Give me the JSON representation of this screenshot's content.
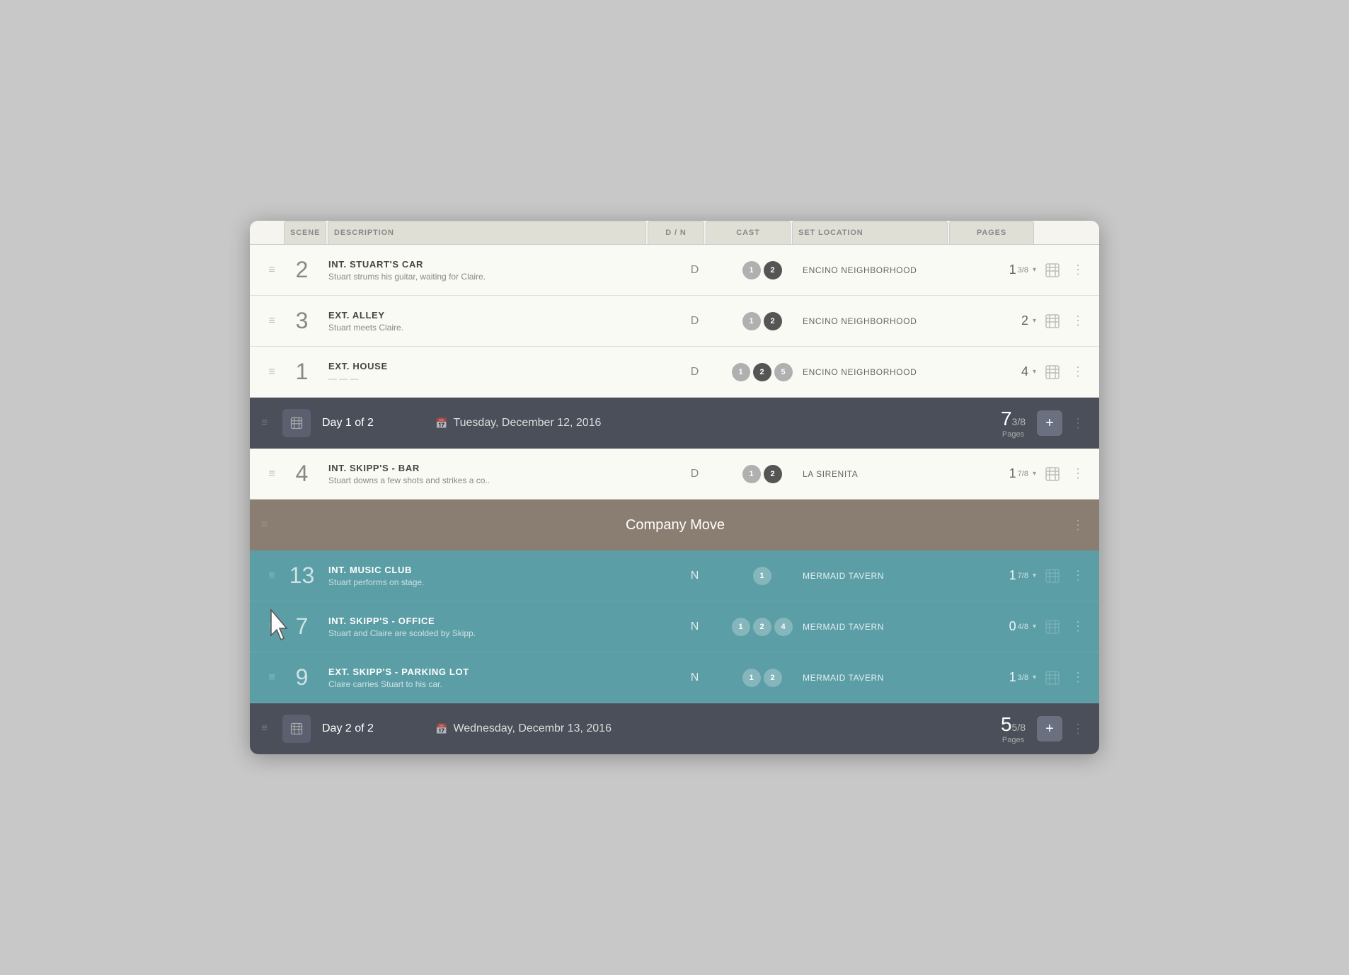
{
  "colors": {
    "bg": "#f5f4ee",
    "day_bar": "#4a4f5a",
    "company_move": "#8a7e72",
    "teal": "#5b9ea6",
    "row_light": "#fafaf4"
  },
  "column_headers": {
    "scene": "SCENE",
    "description": "DESCRIPTION",
    "dm": "D / N",
    "cast": "CAST",
    "location": "SET LOCATION",
    "pages": "PAGES"
  },
  "scenes": [
    {
      "num": "2",
      "title": "INT. STUART'S CAR",
      "description": "Stuart strums his guitar, waiting for Claire.",
      "dm": "D",
      "cast": [
        "1",
        "2"
      ],
      "location": "ENCINO NEIGHBORHOOD",
      "pages_main": "1",
      "pages_frac": "3/8",
      "row_type": "light"
    },
    {
      "num": "3",
      "title": "EXT. ALLEY",
      "description": "Stuart meets Claire.",
      "dm": "D",
      "cast": [
        "1",
        "2"
      ],
      "location": "ENCINO NEIGHBORHOOD",
      "pages_main": "2",
      "pages_frac": "",
      "row_type": "light"
    },
    {
      "num": "1",
      "title": "EXT. HOUSE",
      "description": "",
      "dm": "D",
      "cast": [
        "1",
        "2",
        "5"
      ],
      "location": "ENCINO NEIGHBORHOOD",
      "pages_main": "4",
      "pages_frac": "",
      "row_type": "light"
    }
  ],
  "day1_bar": {
    "title": "Day 1 of 2",
    "date": "Tuesday, December 12, 2016",
    "pages_main": "7",
    "pages_frac": "3/8",
    "pages_label": "Pages"
  },
  "scene4": {
    "num": "4",
    "title": "INT. SKIPP'S - BAR",
    "description": "Stuart downs a few shots and strikes a co..",
    "dm": "D",
    "cast": [
      "1",
      "2"
    ],
    "location": "LA SIRENITA",
    "pages_main": "1",
    "pages_frac": "7/8",
    "row_type": "light"
  },
  "company_move": {
    "title": "Company Move"
  },
  "teal_scenes": [
    {
      "num": "13",
      "title": "INT. MUSIC CLUB",
      "description": "Stuart performs on stage.",
      "dm": "N",
      "cast": [
        "1"
      ],
      "location": "MERMAID TAVERN",
      "pages_main": "1",
      "pages_frac": "7/8"
    },
    {
      "num": "7",
      "title": "INT. SKIPP'S - OFFICE",
      "description": "Stuart and Claire are scolded by Skipp.",
      "dm": "N",
      "cast": [
        "1",
        "2",
        "4"
      ],
      "location": "MERMAID TAVERN",
      "pages_main": "0",
      "pages_frac": "4/8"
    },
    {
      "num": "9",
      "title": "EXT. SKIPP'S - PARKING LOT",
      "description": "Claire carries Stuart to his car.",
      "dm": "N",
      "cast": [
        "1",
        "2"
      ],
      "location": "MERMAID TAVERN",
      "pages_main": "1",
      "pages_frac": "3/8"
    }
  ],
  "day2_bar": {
    "title": "Day 2 of 2",
    "date": "Wednesday, Decembr 13, 2016",
    "pages_main": "5",
    "pages_frac": "5/8",
    "pages_label": "Pages"
  }
}
